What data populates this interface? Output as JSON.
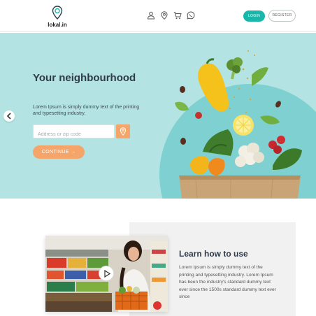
{
  "header": {
    "logo_text": "lokal.in",
    "login_label": "LOGIN",
    "register_label": "REGISTER",
    "icons": [
      "user-icon",
      "location-icon",
      "cart-icon",
      "whatsapp-icon"
    ]
  },
  "hero": {
    "title": "Your neighbourhood",
    "text": "Lorem Ipsum is simply dummy text of the printing and typesetting industry.",
    "address_placeholder": "Address or zip code",
    "address_value": "",
    "continue_label": "CONTINUE →"
  },
  "learn": {
    "title": "Learn how to use",
    "text": "Lorem Ipsum is simply dummy text of the printing and typesetting industry. Lorem Ipsum has been the industry's standard dummy text ever since the 1500s standard dummy text ever since"
  },
  "colors": {
    "accent": "#19b7a9",
    "hero_bg": "#b3e3e3",
    "orange": "#f6a56a"
  }
}
